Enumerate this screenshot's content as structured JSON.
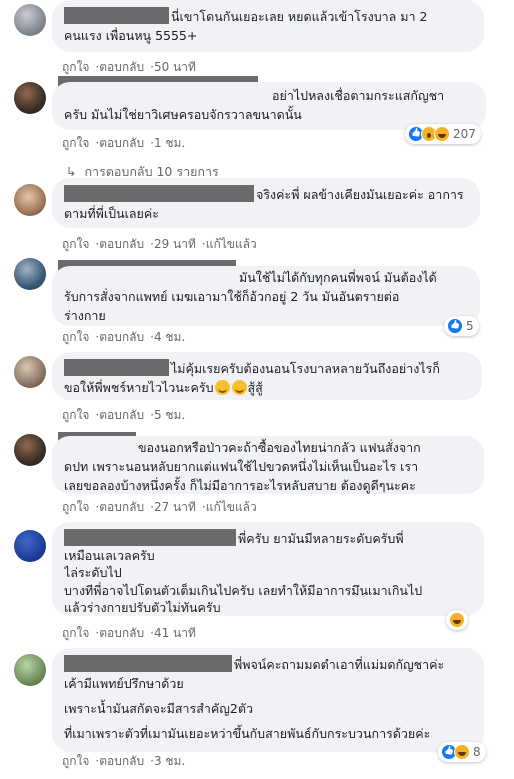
{
  "comments": [
    {
      "lines": [
        "นี่เขาโดนกันเยอะเลย หยดแล้วเข้าโรงบาล มา 2",
        "คนแรง เพื่อนหนู 5555+"
      ],
      "like": "ถูกใจ",
      "reply": "ตอบกลับ",
      "time": "50 นาที"
    },
    {
      "lines": [
        "อย่าไปหลงเชื่อตามกระแสกัญชา",
        "ครับ มันไม่ใช่ยาวิเศษครอบจักรวาลขนาดนั้น"
      ],
      "like": "ถูกใจ",
      "reply": "ตอบกลับ",
      "time": "1 ชม.",
      "reaction_count": "207",
      "replies_label": "การตอบกลับ 10 รายการ"
    },
    {
      "lines": [
        "จริงค่ะพี่ ผลข้างเคียงมันเยอะค่ะ อาการ",
        "ตามที่พี่เป็นเลยค่ะ"
      ],
      "like": "ถูกใจ",
      "reply": "ตอบกลับ",
      "time": "29 นาที",
      "edited": "แก้ไขแล้ว"
    },
    {
      "lines": [
        "มันใช้ไม่ได้กับทุกคนพี่พจน์ มันต้องได้",
        "รับการสั่งจากแพทย์ เมฆเอามาใช้ก็อ้วกอยู่ 2 วัน มันอันตรายต่อ",
        "ร่างกาย"
      ],
      "like": "ถูกใจ",
      "reply": "ตอบกลับ",
      "time": "4 ชม.",
      "reaction_count": "5"
    },
    {
      "lines": [
        "ไม่คุ้มเรยครับต้องนอนโรงบาลหลายวันถึงอย่างไรก็",
        "ขอให้พี่พชร์หายไวไวนะครับ",
        "สู้สู้"
      ],
      "like": "ถูกใจ",
      "reply": "ตอบกลับ",
      "time": "5 ชม."
    },
    {
      "lines": [
        "ของนอกหรือป่าวคะถ้าซื้อของไทยน่ากลัว แฟนสั่งจาก",
        "ดปท เพราะนอนหลับยากแต่แฟนใช้ไปขวดหนึ่งไม่เห็นเป็นอะไร เรา",
        "เลยขอลองบ้างหนึ่งครั้ง ก็ไม่มีอาการอะไรหลับสบาย ต้องดูดีๆนะคะ"
      ],
      "like": "ถูกใจ",
      "reply": "ตอบกลับ",
      "time": "27 นาที",
      "edited": "แก้ไขแล้ว"
    },
    {
      "lines": [
        "พี่ครับ ยามันมีหลายระดับครับพี่",
        "เหมือนเลเวลครับ",
        "ไล่ระดับไป",
        "บางทีพี่อาจไปโดนตัวเต็มเกินไปครับ เลยทำให้มีอาการมึนเมาเกินไป",
        "แล้วร่างกายปรับตัวไม่ทันครับ"
      ],
      "like": "ถูกใจ",
      "reply": "ตอบกลับ",
      "time": "41 นาที"
    },
    {
      "lines": [
        "พี่พจน์คะถามมดตำเอาที่แม่มดกัญชาค่ะ",
        "เค้ามีแพทย์ปรึกษาด้วย",
        "เพราะน้ำมันสกัดจะมีสารสำคัญ2ตัว",
        "ที่เมาเพราะตัวที่เมามันเยอะหว่าขึ้นกับสายพันธ์กับกระบวนการด้วยค่ะ"
      ],
      "like": "ถูกใจ",
      "reply": "ตอบกลับ",
      "time": "3 ชม.",
      "reaction_count": "8"
    }
  ]
}
